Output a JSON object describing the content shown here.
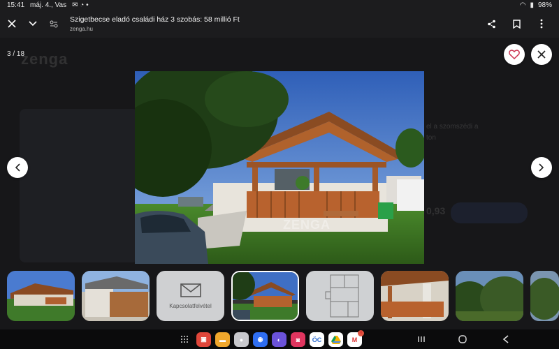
{
  "status_bar": {
    "time": "15:41",
    "date": "máj. 4., Vas",
    "battery": "98%"
  },
  "browser": {
    "title": "Szigetbecse eladó családi ház 3 szobás: 58 millió Ft",
    "domain": "zenga.hu"
  },
  "backdrop": {
    "logo": "zenga",
    "side_text": [
      "el a szomszédi a",
      "ton"
    ],
    "price_partial": "0,93"
  },
  "gallery": {
    "counter": "3 / 18",
    "watermark": "ZENGA",
    "contact_label": "Kapcsolatfelvétel"
  },
  "dock": {
    "apps": [
      {
        "name": "flipboard",
        "color": "#e0463a"
      },
      {
        "name": "files",
        "color": "#f0a72c"
      },
      {
        "name": "bixby",
        "color": "#c8c8cc"
      },
      {
        "name": "messages",
        "color": "#2f6ef2"
      },
      {
        "name": "internet",
        "color": "#6b52d9"
      },
      {
        "name": "gallery",
        "color": "#e0355f"
      },
      {
        "name": "otp",
        "color": "#ffffff"
      },
      {
        "name": "drive",
        "color": "#ffffff"
      },
      {
        "name": "gmail",
        "color": "#ffffff",
        "badge": "4"
      }
    ]
  },
  "colors": {
    "accent": "#cc3351",
    "backdrop": "#171719",
    "bar": "#1c1c1e"
  }
}
